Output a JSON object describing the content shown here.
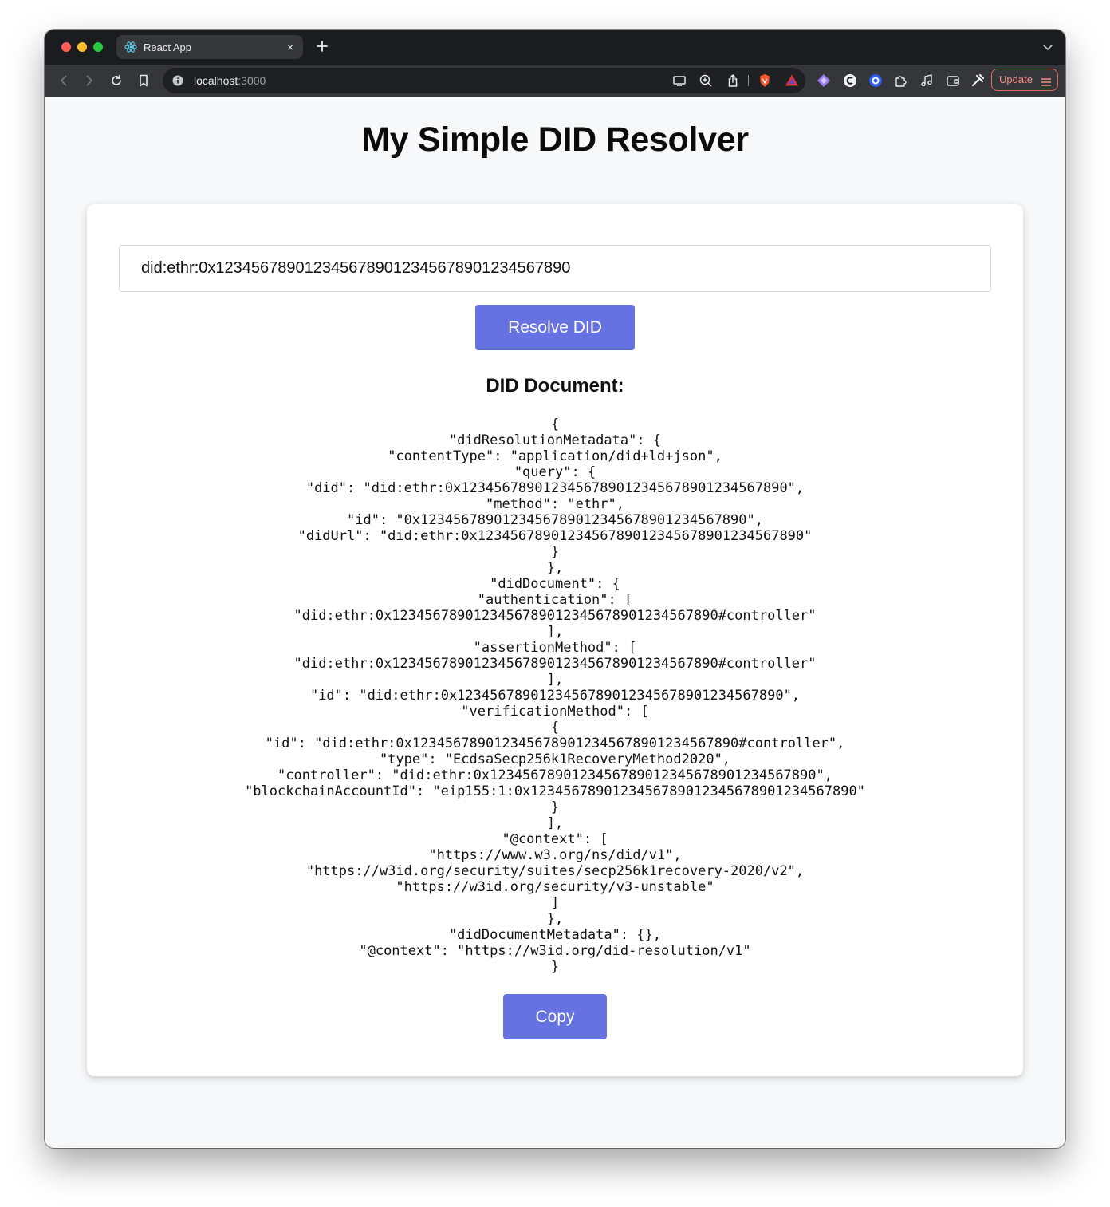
{
  "browser": {
    "tab_title": "React App",
    "tab_close": "×",
    "address_host": "localhost",
    "address_port": ":3000",
    "update_label": "Update"
  },
  "page": {
    "title": "My Simple DID Resolver",
    "did_input_value": "did:ethr:0x1234567890123456789012345678901234567890",
    "resolve_button": "Resolve DID",
    "document_heading": "DID Document:",
    "json_lines": [
      "{",
      "\"didResolutionMetadata\": {",
      "\"contentType\": \"application/did+ld+json\",",
      "\"query\": {",
      "\"did\": \"did:ethr:0x1234567890123456789012345678901234567890\",",
      "\"method\": \"ethr\",",
      "\"id\": \"0x1234567890123456789012345678901234567890\",",
      "\"didUrl\": \"did:ethr:0x1234567890123456789012345678901234567890\"",
      "}",
      "},",
      "\"didDocument\": {",
      "\"authentication\": [",
      "\"did:ethr:0x1234567890123456789012345678901234567890#controller\"",
      "],",
      "\"assertionMethod\": [",
      "\"did:ethr:0x1234567890123456789012345678901234567890#controller\"",
      "],",
      "\"id\": \"did:ethr:0x1234567890123456789012345678901234567890\",",
      "\"verificationMethod\": [",
      "{",
      "\"id\": \"did:ethr:0x1234567890123456789012345678901234567890#controller\",",
      "\"type\": \"EcdsaSecp256k1RecoveryMethod2020\",",
      "\"controller\": \"did:ethr:0x1234567890123456789012345678901234567890\",",
      "\"blockchainAccountId\": \"eip155:1:0x1234567890123456789012345678901234567890\"",
      "}",
      "],",
      "\"@context\": [",
      "\"https://www.w3.org/ns/did/v1\",",
      "\"https://w3id.org/security/suites/secp256k1recovery-2020/v2\",",
      "\"https://w3id.org/security/v3-unstable\"",
      "]",
      "},",
      "\"didDocumentMetadata\": {},",
      "\"@context\": \"https://w3id.org/did-resolution/v1\"",
      "}"
    ],
    "copy_button": "Copy"
  },
  "icons": {
    "tab_favicon": "react-icon",
    "toolbar": [
      "back-icon",
      "forward-icon",
      "reload-icon",
      "bookmark-icon",
      "cast-icon",
      "zoom-icon",
      "share-icon",
      "brave-shield-icon",
      "brave-rewards-icon",
      "extension-diamond-icon",
      "extension-c-icon",
      "extension-circle-icon",
      "puzzle-icon",
      "music-icon",
      "wallet-icon",
      "tools-icon"
    ]
  },
  "colors": {
    "button": "#6672e2",
    "page_bg": "#f6f8fa",
    "update_accent": "#f28b82"
  }
}
